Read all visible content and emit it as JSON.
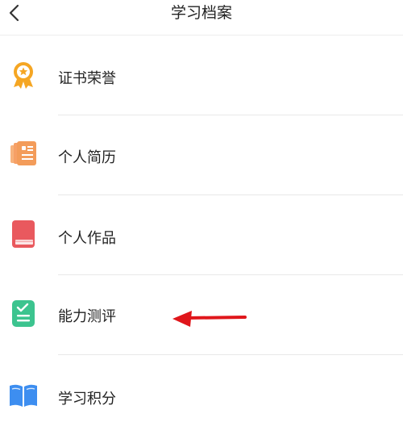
{
  "header": {
    "title": "学习档案",
    "back_icon": "chevron-left-icon"
  },
  "menu": {
    "items": [
      {
        "label": "证书荣誉",
        "icon": "award-medal-icon",
        "icon_color": "#f5a623"
      },
      {
        "label": "个人简历",
        "icon": "resume-card-icon",
        "icon_color": "#f39c5a"
      },
      {
        "label": "个人作品",
        "icon": "book-icon",
        "icon_color": "#e9595e"
      },
      {
        "label": "能力测评",
        "icon": "clipboard-check-icon",
        "icon_color": "#3cc48f"
      },
      {
        "label": "学习积分",
        "icon": "open-book-icon",
        "icon_color": "#3d8ef0"
      }
    ]
  },
  "annotation": {
    "icon": "red-arrow-icon",
    "color": "#e0161b"
  },
  "colors": {
    "text": "#222222",
    "divider": "#e8e8e8"
  }
}
